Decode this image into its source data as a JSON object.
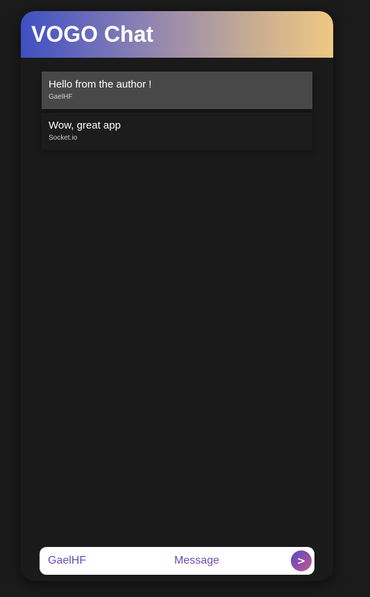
{
  "header": {
    "title": "VOGO Chat"
  },
  "messages": [
    {
      "text": "Hello from the author !",
      "author": "GaelHF",
      "highlighted": true
    },
    {
      "text": "Wow, great app",
      "author": "Socket.io",
      "highlighted": false
    }
  ],
  "composer": {
    "name_value": "GaelHF",
    "message_placeholder": "Message",
    "send_icon": "send-arrow-icon",
    "send_glyph": ">"
  },
  "colors": {
    "background": "#1b1b1b",
    "panel": "#1a1a1a",
    "accent_text": "#6c4bb3",
    "header_gradient_start": "#3f4fc3",
    "header_gradient_end": "#efc882"
  }
}
